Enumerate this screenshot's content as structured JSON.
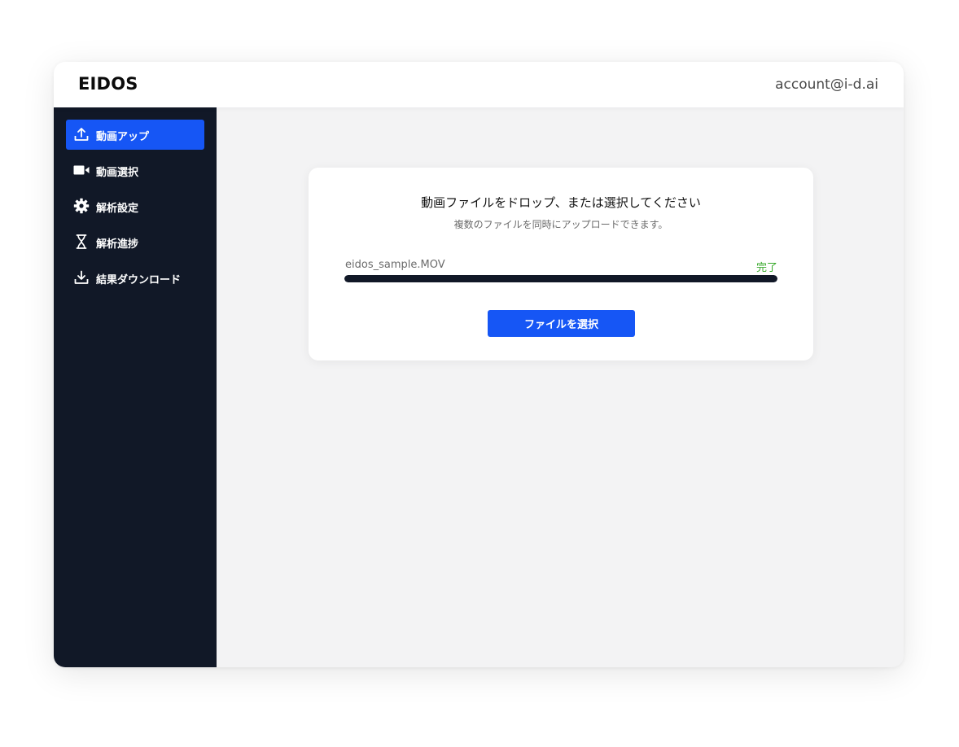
{
  "header": {
    "brand": "EIDOS",
    "account": "account@i-d.ai"
  },
  "sidebar": {
    "items": [
      {
        "label": "動画アップ",
        "icon": "upload-icon",
        "active": true
      },
      {
        "label": "動画選択",
        "icon": "video-camera-icon",
        "active": false
      },
      {
        "label": "解析設定",
        "icon": "gear-icon",
        "active": false
      },
      {
        "label": "解析進捗",
        "icon": "hourglass-icon",
        "active": false
      },
      {
        "label": "結果ダウンロード",
        "icon": "download-icon",
        "active": false
      }
    ]
  },
  "upload": {
    "title": "動画ファイルをドロップ、または選択してください",
    "subtitle": "複数のファイルを同時にアップロードできます。",
    "file": {
      "name": "eidos_sample.MOV",
      "status": "完了",
      "progress_percent": 100
    },
    "select_button_label": "ファイルを選択"
  },
  "colors": {
    "accent": "#1656f5",
    "sidebar_bg": "#111827",
    "status_complete": "#36a829"
  }
}
